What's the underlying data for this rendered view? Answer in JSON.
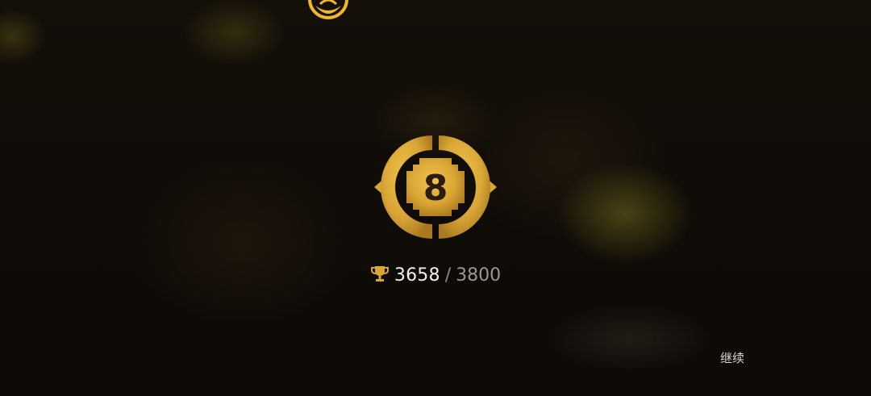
{
  "rank": {
    "level": "8",
    "badge_color": "#d9a635"
  },
  "score": {
    "current": "3658",
    "separator": "/",
    "max": "3800",
    "icon": "trophy-icon"
  },
  "actions": {
    "continue_label": "继续"
  },
  "top_emblem": {
    "icon": "emblem-icon",
    "color": "#f0b728"
  }
}
